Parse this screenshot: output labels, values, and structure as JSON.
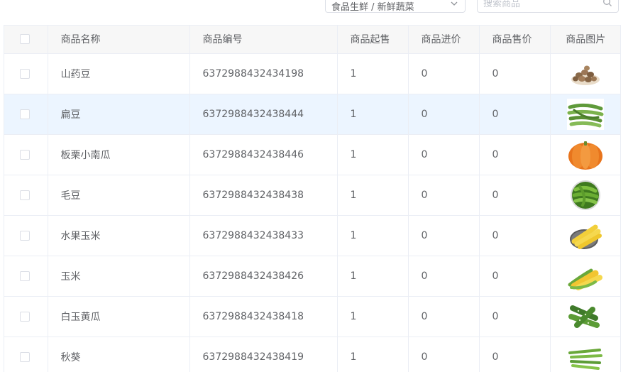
{
  "filters": {
    "category_value": "食品生鲜 / 新鲜蔬菜",
    "search_placeholder": "搜索商品"
  },
  "table": {
    "columns": [
      "商品名称",
      "商品编号",
      "商品起售",
      "商品进价",
      "商品售价",
      "商品图片"
    ],
    "rows": [
      {
        "name": "山药豆",
        "id": "6372988432434198",
        "min": "1",
        "cost": "0",
        "price": "0",
        "image_icon": "yam-beans-icon"
      },
      {
        "name": "扁豆",
        "id": "6372988432438444",
        "min": "1",
        "cost": "0",
        "price": "0",
        "image_icon": "flat-beans-icon"
      },
      {
        "name": "板栗小南瓜",
        "id": "6372988432438446",
        "min": "1",
        "cost": "0",
        "price": "0",
        "image_icon": "pumpkin-icon"
      },
      {
        "name": "毛豆",
        "id": "6372988432438438",
        "min": "1",
        "cost": "0",
        "price": "0",
        "image_icon": "edamame-icon"
      },
      {
        "name": "水果玉米",
        "id": "6372988432438433",
        "min": "1",
        "cost": "0",
        "price": "0",
        "image_icon": "sweet-corn-icon"
      },
      {
        "name": "玉米",
        "id": "6372988432438426",
        "min": "1",
        "cost": "0",
        "price": "0",
        "image_icon": "corn-icon"
      },
      {
        "name": "白玉黄瓜",
        "id": "6372988432438418",
        "min": "1",
        "cost": "0",
        "price": "0",
        "image_icon": "cucumber-icon"
      },
      {
        "name": "秋葵",
        "id": "6372988432438419",
        "min": "1",
        "cost": "0",
        "price": "0",
        "image_icon": "okra-icon"
      }
    ]
  },
  "colors": {
    "header_bg": "#f7f7f7",
    "hover_row_bg": "#ecf5ff",
    "border": "#ebeef5",
    "text": "#606266"
  }
}
